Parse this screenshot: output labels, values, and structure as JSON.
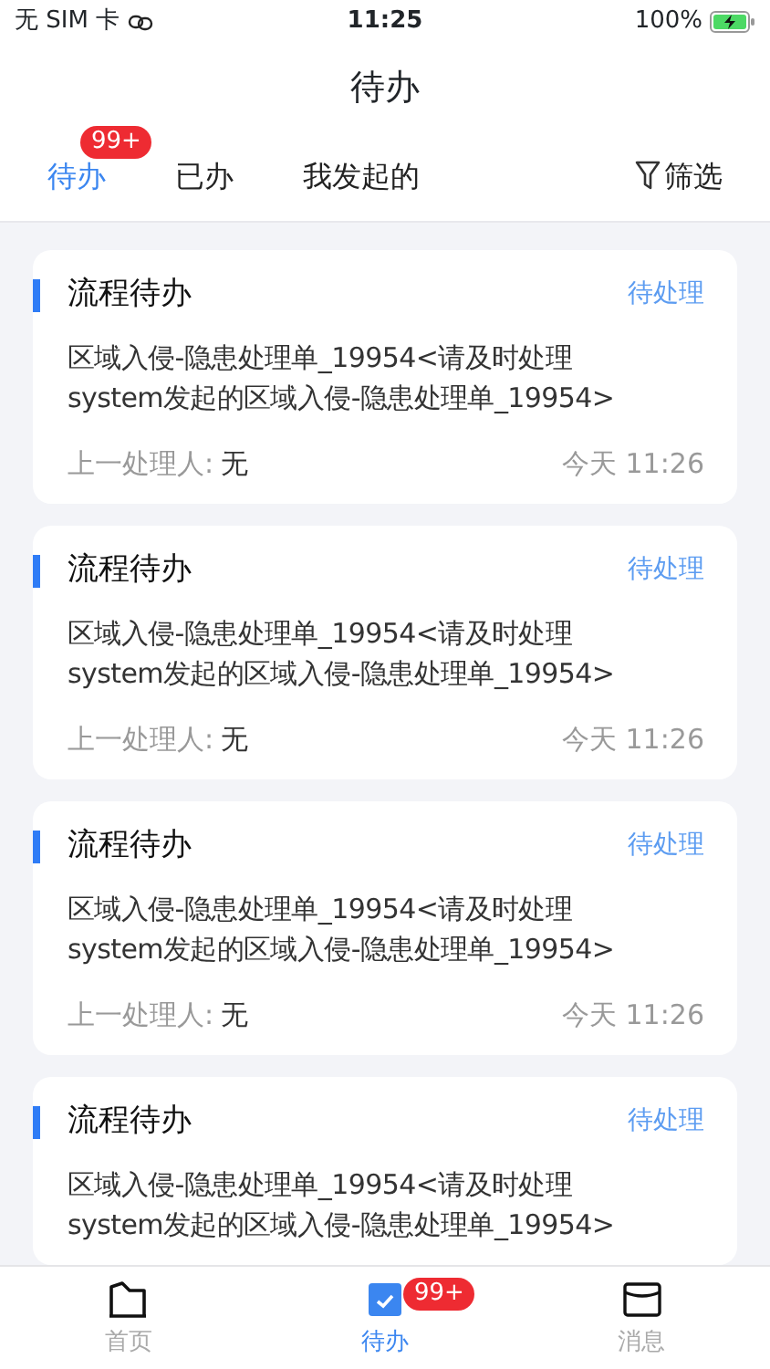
{
  "status_bar": {
    "carrier": "无 SIM 卡",
    "time": "11:25",
    "battery": "100%"
  },
  "header": {
    "title": "待办"
  },
  "tabs": [
    {
      "label": "待办",
      "selected": true,
      "badge": "99+"
    },
    {
      "label": "已办",
      "selected": false
    },
    {
      "label": "我发起的",
      "selected": false
    }
  ],
  "filter": {
    "label": "筛选"
  },
  "cards": [
    {
      "title": "流程待办",
      "status": "待处理",
      "description": "区域入侵-隐患处理单_19954<请及时处理\nsystem发起的区域入侵-隐患处理单_19954>",
      "previous_label": "上一处理人:",
      "previous_value": "无",
      "time": "今天 11:26"
    },
    {
      "title": "流程待办",
      "status": "待处理",
      "description": "区域入侵-隐患处理单_19954<请及时处理\nsystem发起的区域入侵-隐患处理单_19954>",
      "previous_label": "上一处理人:",
      "previous_value": "无",
      "time": "今天 11:26"
    },
    {
      "title": "流程待办",
      "status": "待处理",
      "description": "区域入侵-隐患处理单_19954<请及时处理\nsystem发起的区域入侵-隐患处理单_19954>",
      "previous_label": "上一处理人:",
      "previous_value": "无",
      "time": "今天 11:26"
    },
    {
      "title": "流程待办",
      "status": "待处理",
      "description": "区域入侵-隐患处理单_19954<请及时处理\nsystem发起的区域入侵-隐患处理单_19954>"
    }
  ],
  "tab_bar": [
    {
      "kind": "home",
      "label": "首页",
      "selected": false
    },
    {
      "kind": "todo",
      "label": "待办",
      "selected": true,
      "badge": "99+"
    },
    {
      "kind": "message",
      "label": "消息",
      "selected": false
    }
  ]
}
